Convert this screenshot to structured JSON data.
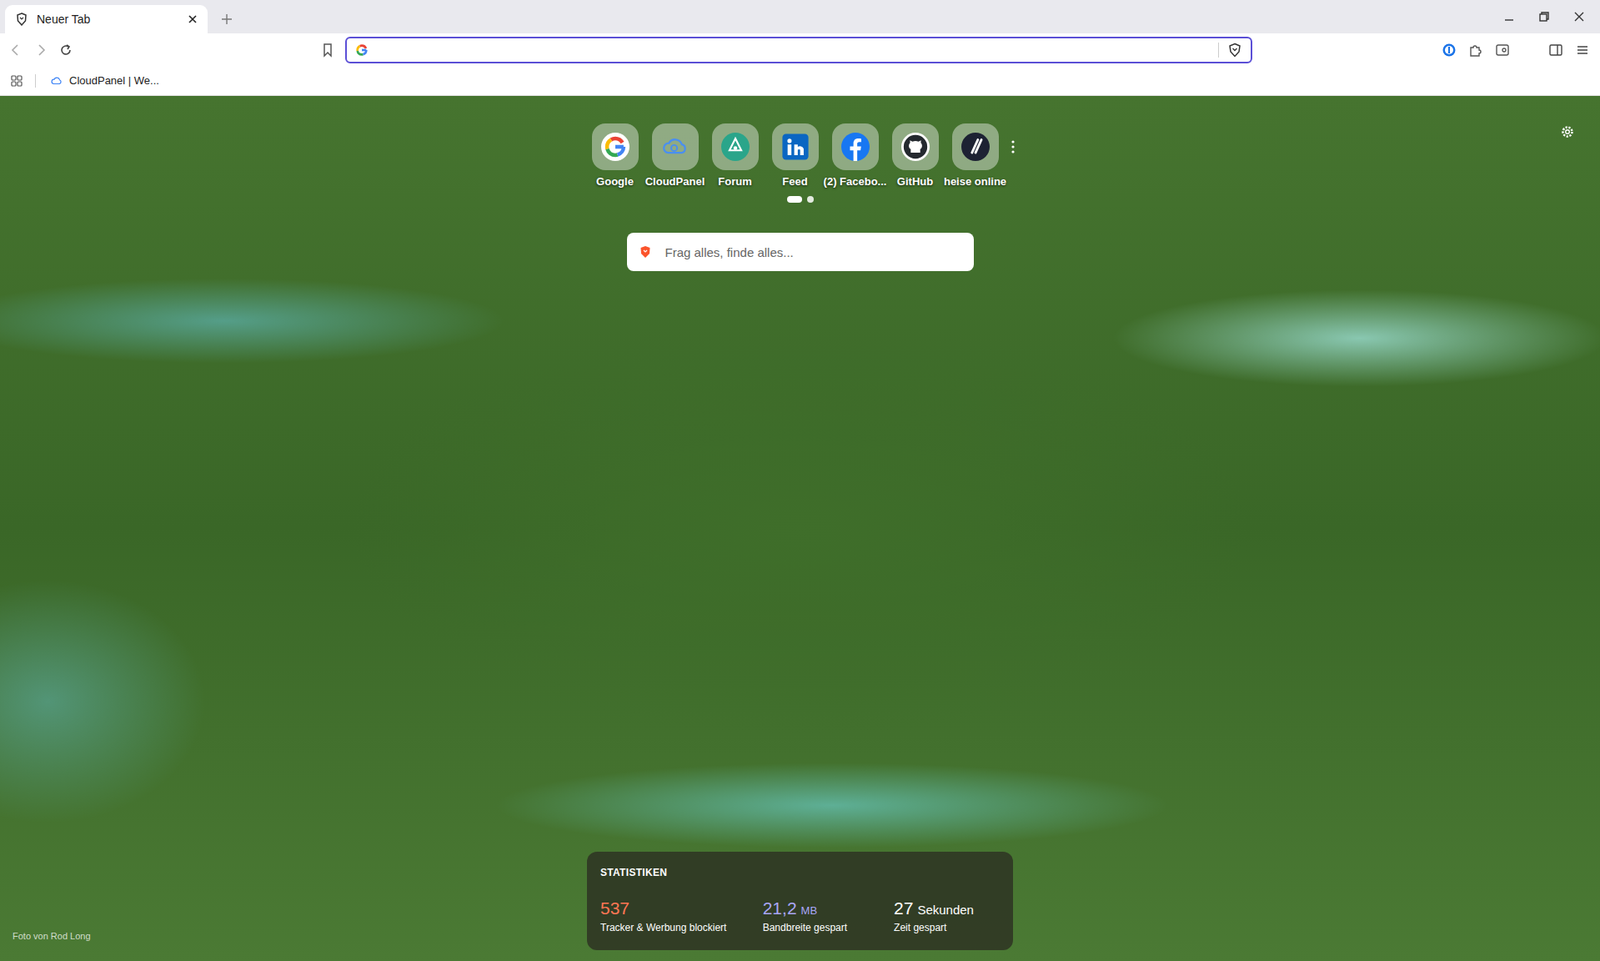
{
  "tabs": [
    {
      "label": "Neuer Tab",
      "selected": true
    }
  ],
  "address_bar": {
    "value": "",
    "focused": true
  },
  "bookmarks": [
    {
      "label": "CloudPanel | We..."
    }
  ],
  "top_sites": [
    {
      "label": "Google",
      "kind": "google"
    },
    {
      "label": "CloudPanel",
      "kind": "cloud"
    },
    {
      "label": "Forum",
      "kind": "forum"
    },
    {
      "label": "Feed",
      "kind": "linkedin"
    },
    {
      "label": "(2) Facebo...",
      "kind": "facebook"
    },
    {
      "label": "GitHub",
      "kind": "github"
    },
    {
      "label": "heise online",
      "kind": "heise"
    }
  ],
  "pages": [
    {
      "selected": true
    },
    {
      "selected": false
    }
  ],
  "search": {
    "placeholder": "Frag alles, finde alles..."
  },
  "stats": {
    "title": "STATISTIKEN",
    "items": [
      {
        "value": "537",
        "unit": "",
        "label": "Tracker & Werbung blockiert",
        "color": "#ff7654"
      },
      {
        "value": "21,2",
        "unit": "MB",
        "label": "Bandbreite gespart",
        "color": "#a9a6f7"
      },
      {
        "value": "27",
        "unit": "Sekunden",
        "label": "Zeit gespart",
        "color": "#ffffff"
      }
    ]
  },
  "photo_credit": "Foto von Rod Long"
}
